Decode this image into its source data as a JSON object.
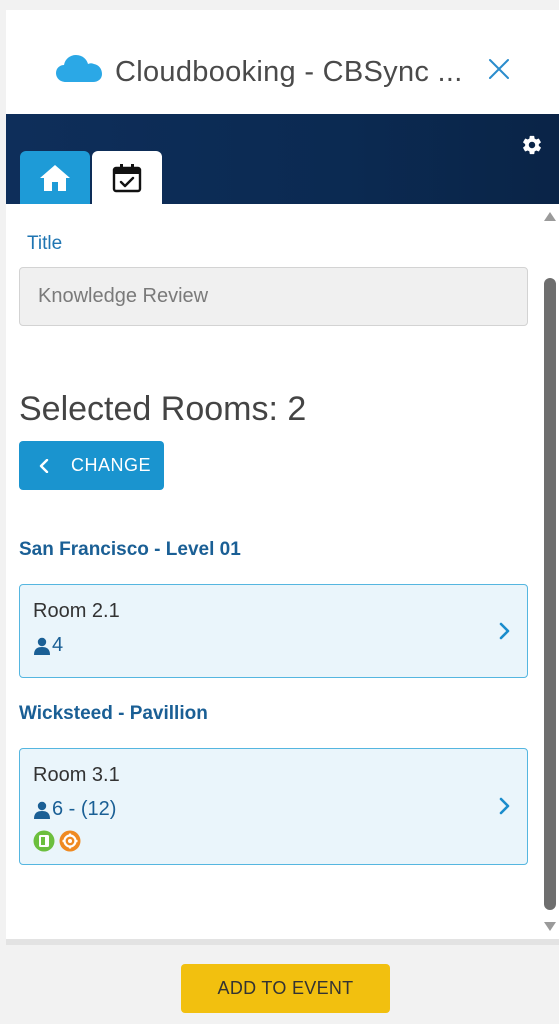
{
  "header": {
    "app_title": "Cloudbooking - CBSync ...",
    "icons": {
      "logo": "cloud-icon",
      "close": "close-icon"
    },
    "colors": {
      "cloud": "#2ba8e6",
      "close": "#2a8ccc"
    }
  },
  "navbar": {
    "tabs": [
      {
        "id": "home",
        "icon": "home-icon",
        "active": false
      },
      {
        "id": "calendar",
        "icon": "calendar-check-icon",
        "active": true
      }
    ],
    "settings_icon": "gear-icon",
    "colors": {
      "background": "#0e2e5a",
      "home_tab": "#1e9bd7"
    }
  },
  "form": {
    "title_label": "Title",
    "title_value": "Knowledge Review"
  },
  "rooms": {
    "selected_label": "Selected Rooms: 2",
    "change_label": "CHANGE",
    "groups": [
      {
        "location": "San Francisco - Level 01",
        "room": {
          "name": "Room 2.1",
          "capacity": "4",
          "features": []
        }
      },
      {
        "location": "Wicksteed - Pavillion",
        "room": {
          "name": "Room 3.1",
          "capacity": "6 - (12)",
          "features": [
            "green-feature-icon",
            "orange-gear-feature-icon"
          ]
        }
      }
    ]
  },
  "footer": {
    "add_label": "ADD TO EVENT",
    "colors": {
      "button": "#f2c00f"
    }
  }
}
